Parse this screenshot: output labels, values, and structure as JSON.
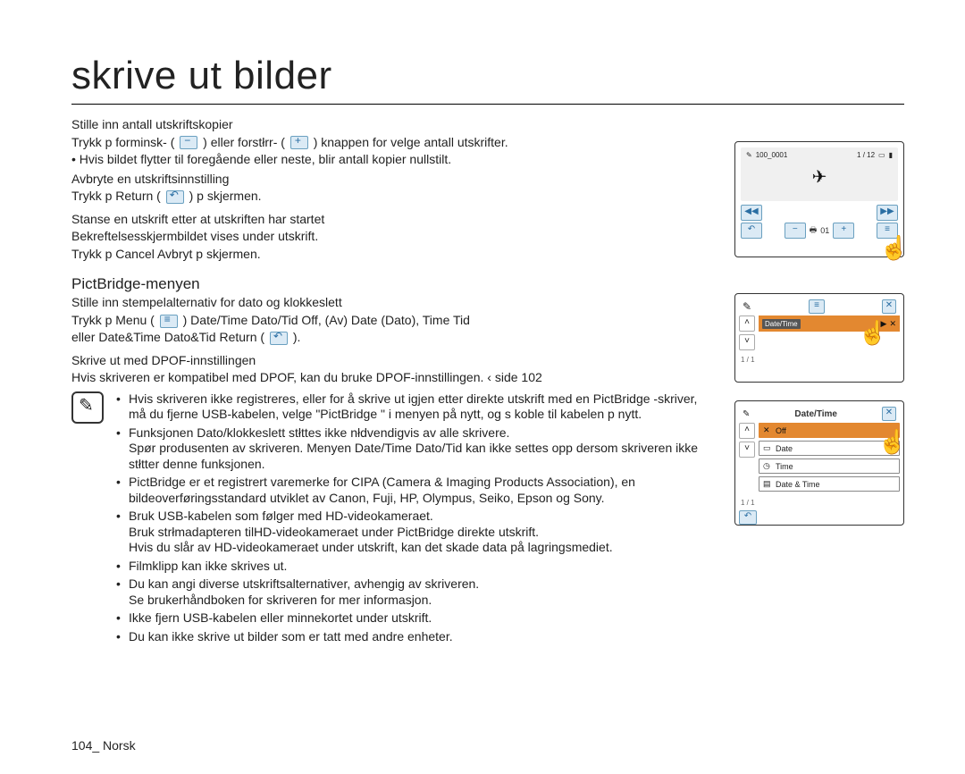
{
  "title": "skrive ut bilder",
  "sec1": {
    "heading": "Stille inn antall utskriftskopier",
    "line_a": "Trykk p forminsk- (",
    "line_b": ") eller forstłrr- (",
    "line_c": ") knappen for velge antall utskrifter.",
    "bullet": "Hvis bildet flytter til foregående eller neste, blir antall kopier nullstilt."
  },
  "sec2": {
    "heading": "Avbryte en utskriftsinnstilling",
    "line_a": "Trykk p Return (",
    "line_b": ") p skjermen."
  },
  "sec3": {
    "heading": "Stanse en utskrift etter at utskriften har startet",
    "line1": "Bekreftelsesskjermbildet vises under utskrift.",
    "line2": "Trykk p  Cancel  Avbryt   p skjermen."
  },
  "pictbridge": {
    "heading": "PictBridge-menyen",
    "stamp_heading": "Stille inn stempelalternativ for dato og klokkeslett",
    "stamp_a": "Trykk p Menu (",
    "stamp_b": ")    Date/Time  Dato/Tid    Off,  (Av)  Date  (Dato),   Time  Tid",
    "stamp_c": "eller  Date&Time  Dato&Tid     Return (",
    "stamp_d": ").",
    "dpof_heading": "Skrive ut med DPOF-innstillingen",
    "dpof_text": "Hvis skriveren er kompatibel med DPOF, kan du bruke DPOF-innstillingen.   ‹ side 102"
  },
  "notes": {
    "n1a": "Hvis skriveren ikke registreres, eller for å skrive ut igjen etter direkte utskrift med en PictBridge -skriver, må du fjerne USB-kabelen, velge \"PictBridge \" i menyen på nytt, og s koble til kabelen p nytt.",
    "n2a": "Funksjonen Dato/klokkeslett stłttes ikke nłdvendigvis av alle skrivere.",
    "n2b": "Spør produsenten av skriveren. Menyen  Date/Time  Dato/Tid   kan ikke settes opp dersom skriveren ikke stłtter denne funksjonen.",
    "n3a": "PictBridge  er et registrert varemerke for CIPA (Camera & Imaging Products Association), en bildeoverføringsstandard utviklet av Canon, Fuji, HP, Olympus, Seiko, Epson og Sony.",
    "n4a": "Bruk USB-kabelen som følger med HD-videokameraet.",
    "n4b": "Bruk strłmadapteren tilHD-videokameraet under PictBridge direkte utskrift.",
    "n4c": "Hvis du slår av HD-videokameraet under utskrift, kan det skade data på lagringsmediet.",
    "n5": "Filmklipp kan ikke skrives ut.",
    "n6a": "Du kan angi diverse utskriftsalternativer, avhengig av skriveren.",
    "n6b": "Se brukerhåndboken for skriveren for mer informasjon.",
    "n7": "Ikke fjern USB-kabelen eller minnekortet under utskrift.",
    "n8": "Du kan ikke skrive ut bilder som er tatt med andre enheter."
  },
  "footer": "104_ Norsk",
  "screens": {
    "a": {
      "folder": "100_0001",
      "counter": "1 / 12",
      "copies_lbl": "01"
    },
    "b": {
      "selected": "Date/Time",
      "page": "1 / 1"
    },
    "c": {
      "title": "Date/Time",
      "items": [
        "Off",
        "Date",
        "Time",
        "Date & Time"
      ],
      "page": "1 / 1"
    }
  }
}
